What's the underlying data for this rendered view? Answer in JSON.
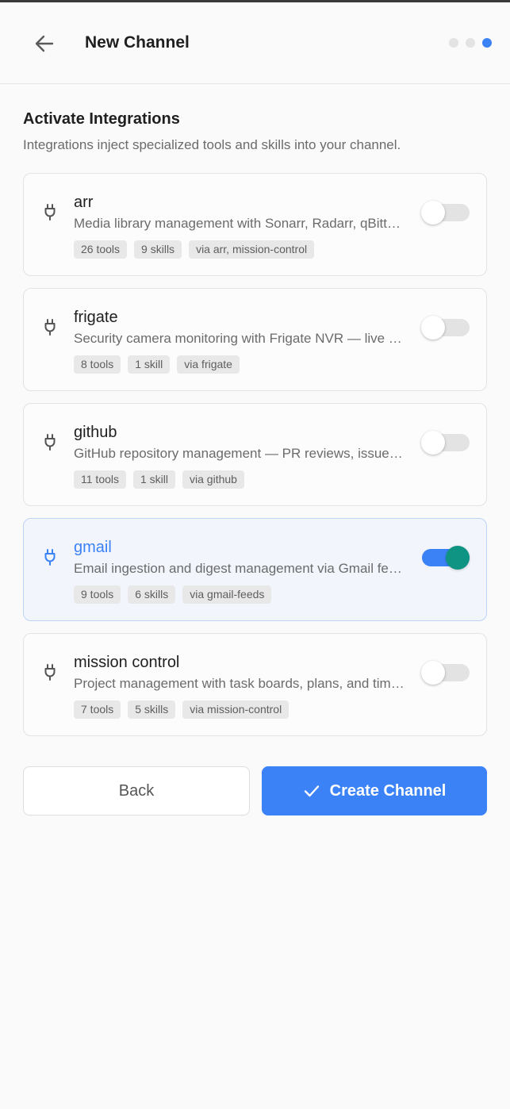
{
  "header": {
    "title": "New Channel",
    "back_icon": "arrow-left-icon",
    "steps": [
      {
        "active": false
      },
      {
        "active": false
      },
      {
        "active": true
      }
    ]
  },
  "section": {
    "title": "Activate Integrations",
    "subtitle": "Integrations inject specialized tools and skills into your channel."
  },
  "integrations": [
    {
      "name": "arr",
      "description": "Media library management with Sonarr, Radarr, qBittorrent and more",
      "tags": [
        "26 tools",
        "9 skills",
        "via arr, mission-control"
      ],
      "enabled": false,
      "icon": "plug-icon"
    },
    {
      "name": "frigate",
      "description": "Security camera monitoring with Frigate NVR — live events and clips",
      "tags": [
        "8 tools",
        "1 skill",
        "via frigate"
      ],
      "enabled": false,
      "icon": "plug-icon"
    },
    {
      "name": "github",
      "description": "GitHub repository management — PR reviews, issues and workflows",
      "tags": [
        "11 tools",
        "1 skill",
        "via github"
      ],
      "enabled": false,
      "icon": "plug-icon"
    },
    {
      "name": "gmail",
      "description": "Email ingestion and digest management via Gmail feeds",
      "tags": [
        "9 tools",
        "6 skills",
        "via gmail-feeds"
      ],
      "enabled": true,
      "icon": "plug-icon"
    },
    {
      "name": "mission control",
      "description": "Project management with task boards, plans, and timelines",
      "tags": [
        "7 tools",
        "5 skills",
        "via mission-control"
      ],
      "enabled": false,
      "icon": "plug-icon"
    }
  ],
  "actions": {
    "back_label": "Back",
    "create_label": "Create Channel",
    "create_icon": "check-icon"
  },
  "colors": {
    "accent": "#3b82f6",
    "toggle_knob_on": "#0f9484",
    "active_card_bg": "#f2f6fc",
    "toggle_off": "#e3e3e3"
  }
}
